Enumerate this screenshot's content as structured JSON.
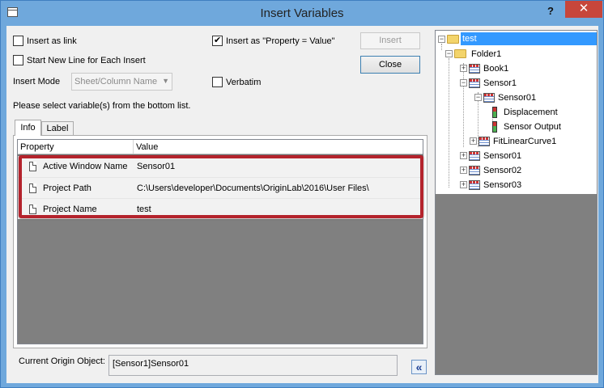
{
  "window": {
    "title": "Insert Variables",
    "help_label": "?",
    "close_label": "✕"
  },
  "options": {
    "insert_as_link": "Insert as link",
    "insert_as_link_checked": false,
    "insert_as_property_value": "Insert as \"Property = Value\"",
    "insert_as_property_value_checked": true,
    "start_new_line": "Start New Line for Each Insert",
    "start_new_line_checked": false,
    "verbatim": "Verbatim",
    "verbatim_checked": false,
    "insert_mode_label": "Insert Mode",
    "insert_mode_value": "Sheet/Column Name"
  },
  "buttons": {
    "insert": "Insert",
    "close": "Close",
    "collapse": "«"
  },
  "instruction": "Please select variable(s) from the bottom list.",
  "tabs": [
    {
      "label": "Info",
      "active": true
    },
    {
      "label": "Label",
      "active": false
    }
  ],
  "grid": {
    "columns": [
      "Property",
      "Value"
    ],
    "rows": [
      {
        "property": "Active Window Name",
        "value": "Sensor01"
      },
      {
        "property": "Project Path",
        "value": "C:\\Users\\developer\\Documents\\OriginLab\\2016\\User Files\\"
      },
      {
        "property": "Project Name",
        "value": "test"
      }
    ]
  },
  "current_object": {
    "label": "Current Origin Object:",
    "value": "[Sensor1]Sensor01"
  },
  "tree": {
    "root": "test",
    "folder1": "Folder1",
    "book1": "Book1",
    "sensor1": "Sensor1",
    "sensor01_sheet": "Sensor01",
    "displacement": "Displacement",
    "sensor_output": "Sensor Output",
    "fitlinearcurve1": "FitLinearCurve1",
    "sensor01": "Sensor01",
    "sensor02": "Sensor02",
    "sensor03": "Sensor03"
  },
  "colors": {
    "titlebar": "#6fa8dc",
    "close": "#c7463b",
    "highlight": "#b4232c",
    "selection": "#3399ff"
  }
}
